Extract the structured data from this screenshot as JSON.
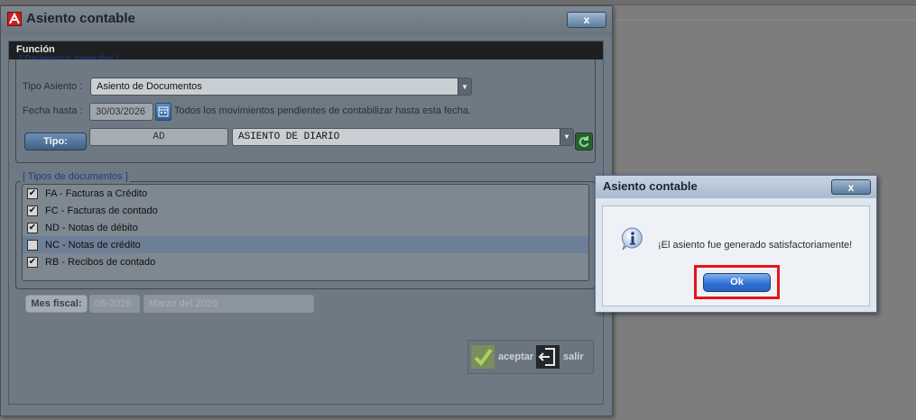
{
  "main_window": {
    "title": "Asiento contable",
    "close_label": "x",
    "function_header": "Función",
    "general_section": {
      "legend": "[ Parámetros generales ]",
      "tipo_asiento_label": "Tipo Asiento :",
      "tipo_asiento_value": "Asiento de Documentos",
      "fecha_hasta_label": "Fecha hasta :",
      "fecha_hasta_value": "30/03/2026",
      "fecha_hasta_note": "Todos los movimientos pendientes de contabilizar hasta esta fecha.",
      "tipo_button_label": "Tipo:",
      "tipo_code": "AD",
      "tipo_description": "ASIENTO DE DIARIO"
    },
    "docs_section": {
      "legend": "[ Tipos de documentos ]",
      "items": [
        {
          "label": "FA - Facturas a Crédito",
          "checked": true,
          "selected": false
        },
        {
          "label": "FC - Facturas de contado",
          "checked": true,
          "selected": false
        },
        {
          "label": "ND - Notas de débito",
          "checked": true,
          "selected": false
        },
        {
          "label": "NC - Notas de crédito",
          "checked": false,
          "selected": true
        },
        {
          "label": "RB - Recibos de contado",
          "checked": true,
          "selected": false
        }
      ]
    },
    "mes_fiscal": {
      "button_label": "Mes fiscal:",
      "code": "08-2026",
      "description": "Marzo del 2026"
    },
    "actions": {
      "accept_label": "aceptar",
      "exit_label": "salir"
    }
  },
  "dialog": {
    "title": "Asiento contable",
    "close_label": "x",
    "message": "¡El asiento fue generado satisfactoriamente!",
    "ok_label": "Ok",
    "icon": "info-icon"
  },
  "colors": {
    "highlight": "#e5141a",
    "ok_button": "#2c6ed4",
    "accept_check": "#8bc34a"
  }
}
